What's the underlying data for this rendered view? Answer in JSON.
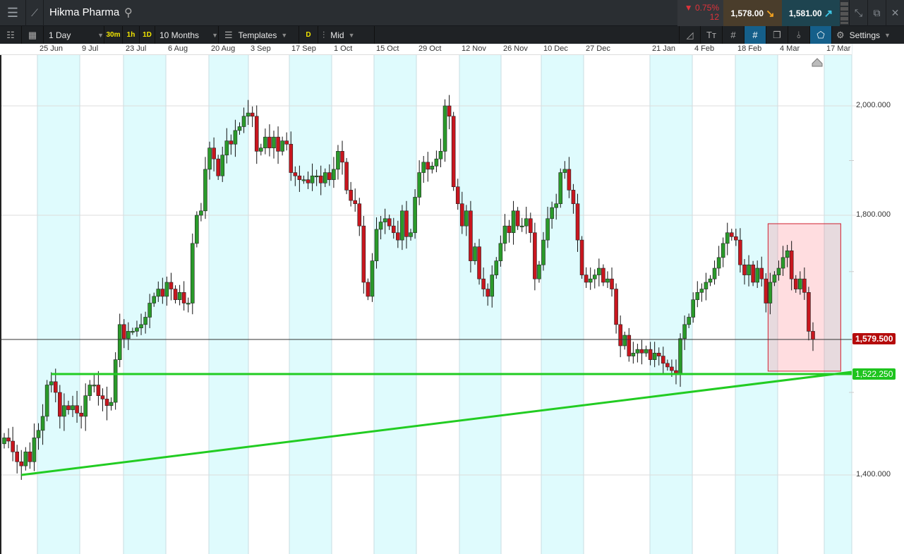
{
  "header": {
    "instrument": "Hikma Pharma",
    "change_pct": "▼ 0.75%",
    "change_pts": "12",
    "sell_price": "1,578.00",
    "buy_price": "1,581.00",
    "sell_arrow": "↘",
    "buy_arrow": "↗"
  },
  "toolbar": {
    "interval": "1 Day",
    "quick_intervals": [
      "30m",
      "1h",
      "1D"
    ],
    "range": "10 Months",
    "templates": "Templates",
    "d_label": "D",
    "price_type": "Mid",
    "settings": "Settings"
  },
  "colors": {
    "up": "#2a9a2a",
    "down": "#c8161e",
    "band": "#dffbfd",
    "trend": "#22cc22",
    "last": "#b50b0b"
  },
  "chart_data": {
    "type": "candlestick",
    "title": "Hikma Pharma",
    "x_ticks": [
      "25 Jun",
      "9 Jul",
      "23 Jul",
      "6 Aug",
      "20 Aug",
      "3 Sep",
      "17 Sep",
      "1 Oct",
      "15 Oct",
      "29 Oct",
      "12 Nov",
      "26 Nov",
      "10 Dec",
      "27 Dec",
      "21 Jan",
      "4 Feb",
      "18 Feb",
      "4 Mar",
      "17 Mar"
    ],
    "y_ticks": [
      "2,000.000",
      "1,800.000",
      "1,400.000"
    ],
    "y_tick_values": [
      2000,
      1800,
      1400
    ],
    "ylim": [
      1330,
      2090
    ],
    "scale": "log-like",
    "closes": [
      1445,
      1441,
      1428,
      1416,
      1411,
      1428,
      1416,
      1445,
      1454,
      1471,
      1509,
      1513,
      1500,
      1471,
      1484,
      1479,
      1484,
      1475,
      1471,
      1496,
      1509,
      1509,
      1496,
      1492,
      1484,
      1488,
      1546,
      1606,
      1581,
      1594,
      1594,
      1600,
      1606,
      1619,
      1644,
      1656,
      1669,
      1656,
      1681,
      1669,
      1650,
      1663,
      1644,
      1644,
      1750,
      1800,
      1808,
      1884,
      1923,
      1903,
      1872,
      1910,
      1936,
      1930,
      1955,
      1962,
      1981,
      1987,
      1981,
      1917,
      1923,
      1943,
      1923,
      1943,
      1917,
      1936,
      1930,
      1878,
      1872,
      1865,
      1865,
      1859,
      1872,
      1872,
      1859,
      1878,
      1865,
      1884,
      1917,
      1897,
      1846,
      1827,
      1821,
      1781,
      1681,
      1656,
      1719,
      1775,
      1788,
      1794,
      1781,
      1769,
      1756,
      1808,
      1762,
      1769,
      1833,
      1878,
      1897,
      1884,
      1890,
      1903,
      1917,
      2000,
      1981,
      1852,
      1821,
      1781,
      1808,
      1719,
      1744,
      1687,
      1669,
      1656,
      1694,
      1719,
      1750,
      1781,
      1769,
      1808,
      1781,
      1781,
      1794,
      1769,
      1687,
      1712,
      1756,
      1794,
      1814,
      1821,
      1878,
      1884,
      1846,
      1821,
      1756,
      1694,
      1681,
      1687,
      1694,
      1706,
      1681,
      1687,
      1669,
      1606,
      1569,
      1587,
      1552,
      1557,
      1563,
      1557,
      1563,
      1546,
      1557,
      1552,
      1540,
      1534,
      1528,
      1522,
      1581,
      1606,
      1619,
      1650,
      1663,
      1669,
      1681,
      1687,
      1706,
      1725,
      1750,
      1769,
      1762,
      1756,
      1712,
      1694,
      1712,
      1681,
      1706,
      1687,
      1644,
      1681,
      1694,
      1706,
      1725,
      1737,
      1687,
      1669,
      1687,
      1663,
      1594,
      1579.5
    ],
    "last_price": 1579.5,
    "last_price_label": "1,579.500",
    "support_level": 1522.25,
    "support_label": "1,522.250",
    "support_start_index": 11,
    "trendline": {
      "start_index": 4,
      "start_price": 1400,
      "end_price": 1522.25
    },
    "highlight_box": {
      "start_index": 179,
      "top_price": 1785,
      "bottom_price": 1527
    }
  }
}
